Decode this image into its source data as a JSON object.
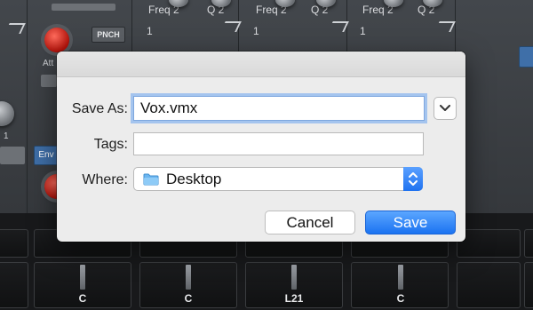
{
  "background": {
    "freq_labels": [
      "Freq 2",
      "Freq 2",
      "Freq 2"
    ],
    "q_labels": [
      "Q 2",
      "Q 2",
      "Q 2"
    ],
    "one_values": [
      "1",
      "1",
      "1"
    ],
    "pnch_label": "PNCH",
    "att_label": "Att",
    "small_value": "1",
    "env_label": "Env",
    "channel_labels": [
      "C",
      "C",
      "L21",
      "C"
    ]
  },
  "dialog": {
    "save_as_label": "Save As:",
    "save_as_value": "Vox.vmx",
    "tags_label": "Tags:",
    "tags_value": "",
    "where_label": "Where:",
    "where_value": "Desktop",
    "cancel_label": "Cancel",
    "save_label": "Save"
  },
  "colors": {
    "accent_blue": "#1b73f1",
    "knob_red": "#d2261a",
    "dialog_bg": "#ececec"
  },
  "icons": {
    "disclosure": "chevron-down-icon",
    "folder": "folder-icon",
    "stepper": "up-down-stepper-icon"
  }
}
